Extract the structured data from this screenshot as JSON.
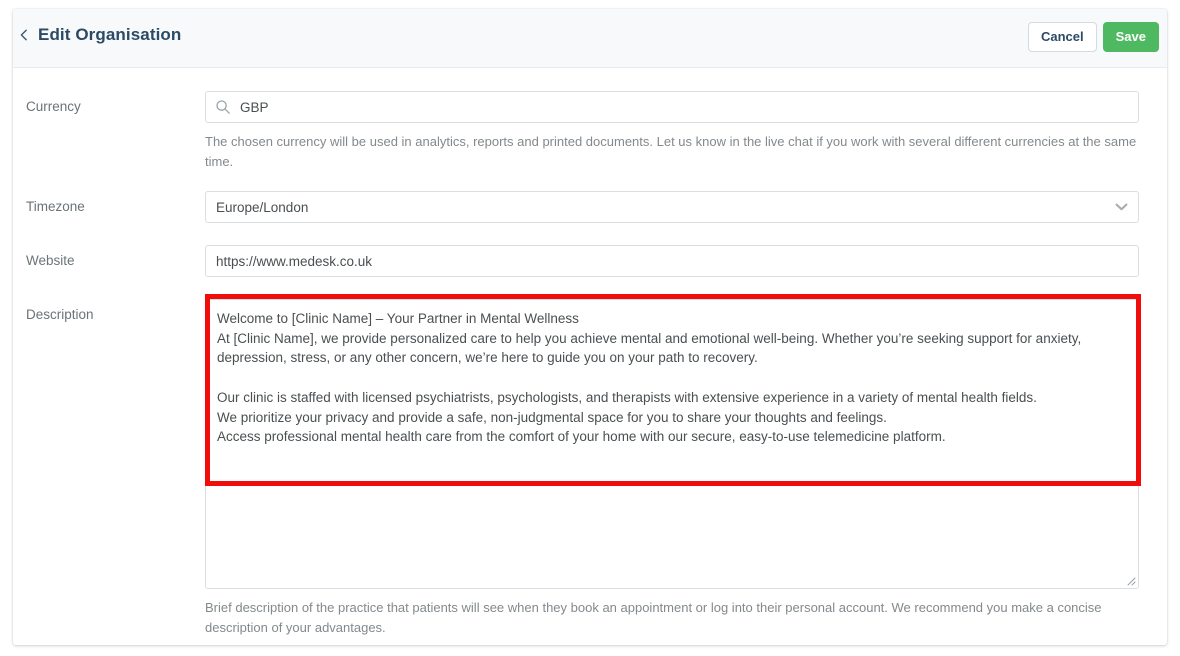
{
  "header": {
    "back_icon": "chevron-left-icon",
    "title": "Edit Organisation",
    "cancel_label": "Cancel",
    "save_label": "Save",
    "save_color": "#4fb961",
    "cancel_text_color": "#2c4a66",
    "title_color": "#2c4a66",
    "background": "#f7f9fa"
  },
  "fields": {
    "currency": {
      "label": "Currency",
      "icon": "search-icon",
      "value": "GBP",
      "help": "The chosen currency will be used in analytics, reports and printed documents. Let us know in the live chat if you work with several different currencies at the same time."
    },
    "timezone": {
      "label": "Timezone",
      "value": "Europe/London",
      "icon": "chevron-down-icon"
    },
    "website": {
      "label": "Website",
      "value": "https://www.medesk.co.uk"
    },
    "description": {
      "label": "Description",
      "lines": [
        "Welcome to [Clinic Name] – Your Partner in Mental Wellness",
        "At [Clinic Name], we provide personalized care to help you achieve mental and emotional well-being. Whether you’re seeking support for anxiety,",
        "depression, stress, or any other concern, we’re here to guide you on your path to recovery.",
        "",
        "Our clinic is staffed with licensed psychiatrists, psychologists, and therapists with extensive experience in a variety of mental health fields.",
        "We prioritize your privacy and provide a safe, non-judgmental space for you to share your thoughts and feelings.",
        "Access professional mental health care from the comfort of your home with our secure, easy-to-use telemedicine platform."
      ],
      "help": "Brief description of the practice that patients will see when they book an appointment or log into their personal account. We recommend you make a concise description of your advantages.",
      "resize_handle": "resize-grip-icon"
    }
  },
  "annotation": {
    "highlight_color": "#f20d0d",
    "target": "description-textarea"
  }
}
